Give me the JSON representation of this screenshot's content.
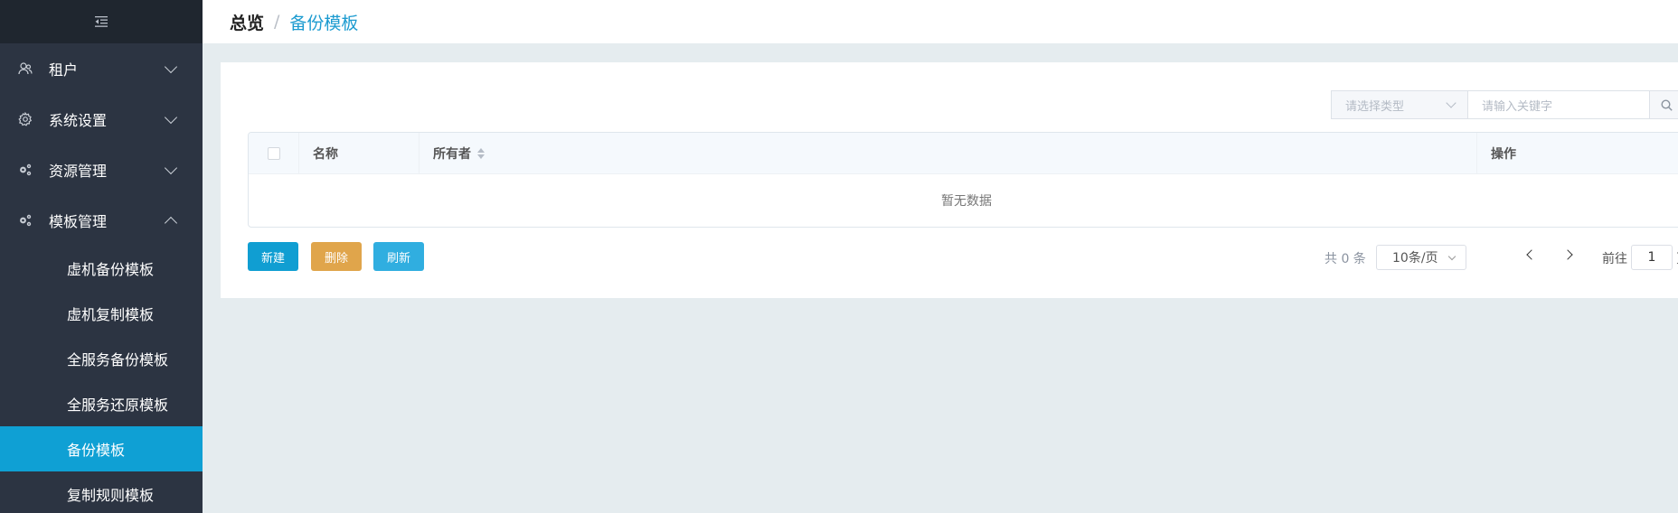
{
  "sidebar": {
    "collapse_icon": "menu-fold-icon",
    "menus": [
      {
        "label": "租户",
        "icon": "users-icon",
        "expanded": false
      },
      {
        "label": "系统设置",
        "icon": "gear-icon",
        "expanded": false
      },
      {
        "label": "资源管理",
        "icon": "cogs-icon",
        "expanded": false
      },
      {
        "label": "模板管理",
        "icon": "cogs-icon",
        "expanded": true
      }
    ],
    "sub_items": [
      {
        "label": "虚机备份模板"
      },
      {
        "label": "虚机复制模板"
      },
      {
        "label": "全服务备份模板"
      },
      {
        "label": "全服务还原模板"
      },
      {
        "label": "备份模板",
        "active": true
      },
      {
        "label": "复制规则模板"
      }
    ]
  },
  "breadcrumb": {
    "home": "总览",
    "separator": "/",
    "current": "备份模板"
  },
  "filters": {
    "type_placeholder": "请选择类型",
    "keyword_placeholder": "请输入关键字",
    "search_icon": "search-icon"
  },
  "table": {
    "columns": [
      "名称",
      "所有者",
      "操作"
    ],
    "empty_text": "暂无数据"
  },
  "actions": {
    "new_label": "新建",
    "delete_label": "删除",
    "refresh_label": "刷新"
  },
  "pagination": {
    "total_text": "共 0 条",
    "page_size": "10条/页",
    "goto_label": "前往",
    "current_page": "1",
    "unit_label": "页"
  },
  "colors": {
    "sidebar_bg": "#2c3442",
    "active_item": "#0fa0d4",
    "new_button": "#109ed2",
    "delete_button": "#e0a54b",
    "refresh_button": "#30aee0",
    "breadcrumb_current": "#1c9bd0"
  }
}
